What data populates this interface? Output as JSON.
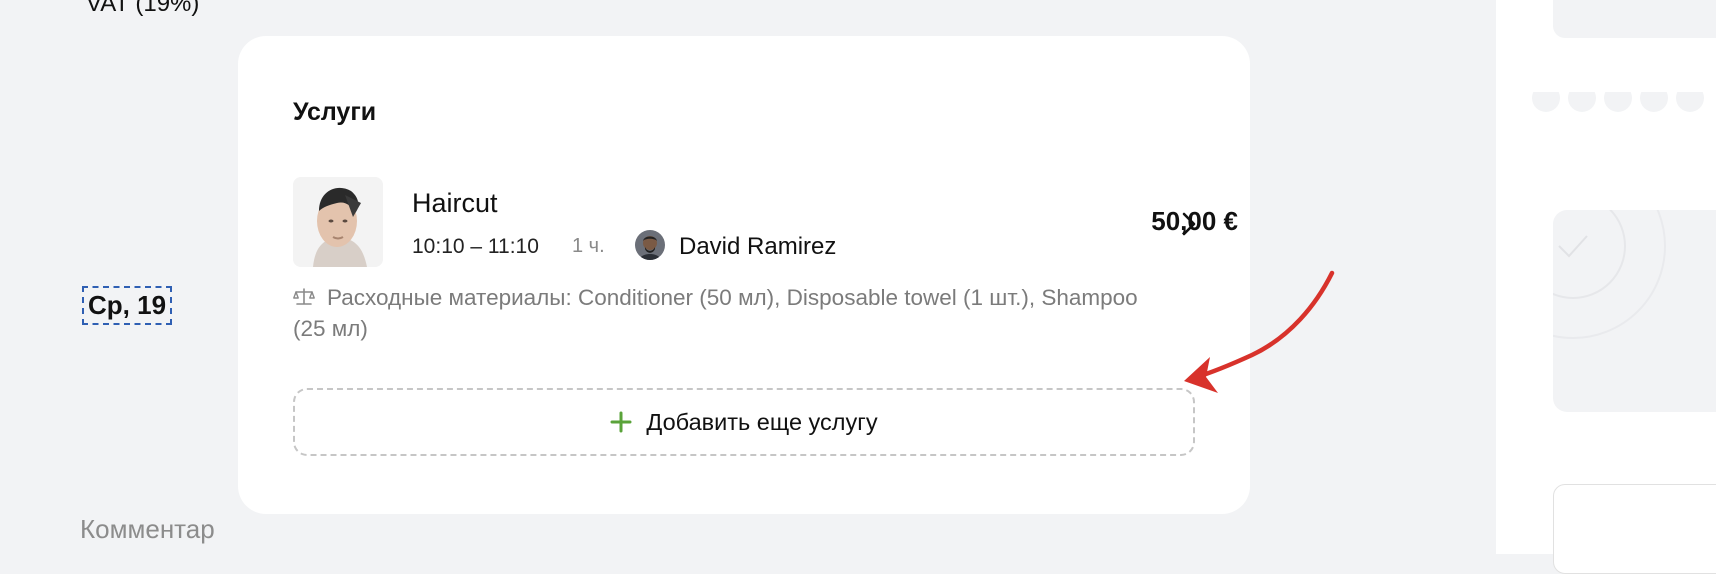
{
  "services": {
    "title": "Услуги",
    "item": {
      "name": "Haircut",
      "time_range": "10:10 – 11:10",
      "duration": "1 ч.",
      "staff_name": "David Ramirez",
      "price": "50,00 €",
      "materials": "Расходные материалы: Conditioner (50 мл), Disposable towel (1 шт.), Shampoo (25 мл)"
    },
    "add_button_label": "Добавить еще услугу"
  },
  "sidebar": {
    "vat_label": "VAT (19%)",
    "date_label": "Ср, 19",
    "comment_placeholder": "Комментар"
  },
  "colors": {
    "accent_green": "#5aa33a",
    "annotation_arrow": "#d8322b",
    "page_background": "#f2f3f5"
  },
  "icons": [
    "service-photo",
    "staff-avatar",
    "chevron-right-icon",
    "scale-icon",
    "plus-icon"
  ]
}
